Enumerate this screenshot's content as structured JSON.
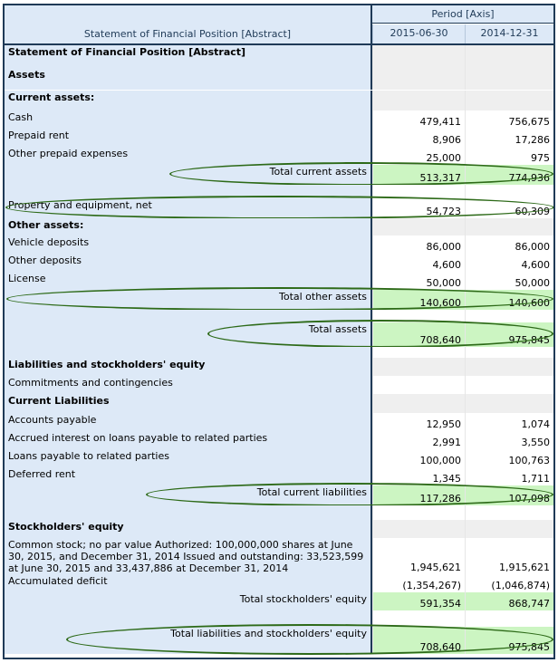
{
  "header": {
    "axis_label": "Period [Axis]",
    "statement_label": "Statement of Financial Position [Abstract]",
    "periods": [
      "2015-06-30",
      "2014-12-31"
    ]
  },
  "colors": {
    "label_bg": "#dde9f7",
    "total_bg": "#ccf5c2",
    "border": "#1f3a57",
    "highlight_ellipse": "#2d6a18"
  },
  "rows": [
    {
      "label": "Statement of Financial Position [Abstract]",
      "kind": "section",
      "v1": "",
      "v2": ""
    },
    {
      "label": "Assets",
      "kind": "section",
      "v1": "",
      "v2": ""
    },
    {
      "label": "Current assets:",
      "kind": "section",
      "v1": "",
      "v2": ""
    },
    {
      "label": "Cash",
      "kind": "item",
      "v1": "479,411",
      "v2": "756,675"
    },
    {
      "label": "Prepaid rent",
      "kind": "item",
      "v1": "8,906",
      "v2": "17,286"
    },
    {
      "label": "Other prepaid expenses",
      "kind": "item",
      "v1": "25,000",
      "v2": "975"
    },
    {
      "label": "Total current assets",
      "kind": "total",
      "v1": "513,317",
      "v2": "774,936",
      "highlighted": true
    },
    {
      "label": "",
      "kind": "spacer",
      "v1": "",
      "v2": ""
    },
    {
      "label": "Property and equipment, net",
      "kind": "item",
      "v1": "54,723",
      "v2": "60,309",
      "highlighted": true
    },
    {
      "label": "Other assets:",
      "kind": "section",
      "v1": "",
      "v2": ""
    },
    {
      "label": "Vehicle deposits",
      "kind": "item",
      "v1": "86,000",
      "v2": "86,000"
    },
    {
      "label": "Other deposits",
      "kind": "item",
      "v1": "4,600",
      "v2": "4,600"
    },
    {
      "label": "License",
      "kind": "item",
      "v1": "50,000",
      "v2": "50,000"
    },
    {
      "label": "Total other assets",
      "kind": "total",
      "v1": "140,600",
      "v2": "140,600",
      "highlighted": true
    },
    {
      "label": "",
      "kind": "spacer",
      "v1": "",
      "v2": ""
    },
    {
      "label": "Total assets",
      "kind": "total",
      "v1": "708,640",
      "v2": "975,845",
      "highlighted": true
    },
    {
      "label": "",
      "kind": "spacer",
      "v1": "",
      "v2": ""
    },
    {
      "label": "Liabilities and stockholders' equity",
      "kind": "section",
      "v1": "",
      "v2": ""
    },
    {
      "label": "Commitments and contingencies",
      "kind": "item",
      "v1": "",
      "v2": ""
    },
    {
      "label": "Current Liabilities",
      "kind": "section",
      "v1": "",
      "v2": ""
    },
    {
      "label": "Accounts payable",
      "kind": "item",
      "v1": "12,950",
      "v2": "1,074"
    },
    {
      "label": "Accrued interest on loans payable to related parties",
      "kind": "item",
      "v1": "2,991",
      "v2": "3,550"
    },
    {
      "label": "Loans payable to related parties",
      "kind": "item",
      "v1": "100,000",
      "v2": "100,763"
    },
    {
      "label": "Deferred rent",
      "kind": "item",
      "v1": "1,345",
      "v2": "1,711"
    },
    {
      "label": "Total current liabilities",
      "kind": "total",
      "v1": "117,286",
      "v2": "107,098",
      "highlighted": true
    },
    {
      "label": "",
      "kind": "spacer",
      "v1": "",
      "v2": ""
    },
    {
      "label": "Stockholders' equity",
      "kind": "section",
      "v1": "",
      "v2": ""
    },
    {
      "label": "Common stock; no par value Authorized: 100,000,000 shares at June 30, 2015, and December 31, 2014 Issued and outstanding: 33,523,599 at June 30, 2015 and 33,437,886 at December 31, 2014",
      "kind": "item",
      "v1": "1,945,621",
      "v2": "1,915,621"
    },
    {
      "label": "Accumulated deficit",
      "kind": "item",
      "v1": "(1,354,267)",
      "v2": "(1,046,874)"
    },
    {
      "label": "Total stockholders' equity",
      "kind": "total",
      "v1": "591,354",
      "v2": "868,747"
    },
    {
      "label": "",
      "kind": "spacer",
      "v1": "",
      "v2": ""
    },
    {
      "label": "Total liabilities and stockholders' equity",
      "kind": "total",
      "v1": "708,640",
      "v2": "975,845",
      "highlighted": true
    }
  ]
}
